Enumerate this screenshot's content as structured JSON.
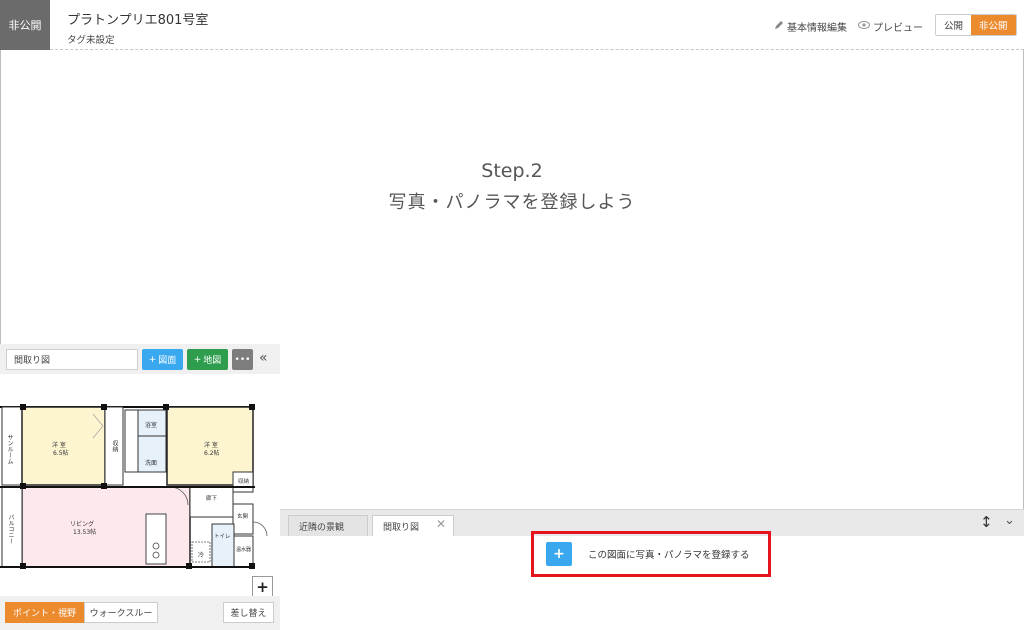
{
  "header": {
    "status_badge": "非公開",
    "property_title": "プラトンプリエ801号室",
    "tag_label": "タグ未設定",
    "edit_link": "基本情報編集",
    "preview_link": "プレビュー",
    "publish_label": "公開",
    "unpublish_label": "非公開"
  },
  "step": {
    "title": "Step.2",
    "subtitle": "写真・パノラマを登録しよう"
  },
  "floorplan_panel": {
    "select_value": "間取り図",
    "add_plan_label": "図面",
    "add_map_label": "地図",
    "more_label": "•••",
    "mode_point": "ポイント・視野",
    "mode_walk": "ウォークスルー",
    "replace_label": "差し替え",
    "zoom_in": "+",
    "zoom_out": "−",
    "rooms": {
      "sunroom": "サンルーム",
      "western1": "洋 室",
      "western1_size": "6.5帖",
      "storage1": "収納",
      "bath": "浴室",
      "wash": "洗面",
      "western2": "洋 室",
      "western2_size": "6.2帖",
      "storage2": "収納",
      "corridor": "廊下",
      "entrance": "玄関",
      "living": "リビング",
      "living_size": "13.53帖",
      "fridge": "冷",
      "toilet": "トイレ",
      "balcony": "バルコニー",
      "water_heater": "温水器"
    }
  },
  "tabs": {
    "neighbor": "近隣の景観",
    "floor": "間取り図"
  },
  "add_panorama": {
    "label": "この図面に写真・パノラマを登録する"
  },
  "colors": {
    "accent_orange": "#ec8a2e",
    "button_blue": "#3aa8ee",
    "button_green": "#2f9d4e",
    "highlight_red": "#e6141c",
    "room_yellow": "#fdf5d0",
    "room_pink": "#fde8ec",
    "room_blue": "#e6f1fa"
  }
}
